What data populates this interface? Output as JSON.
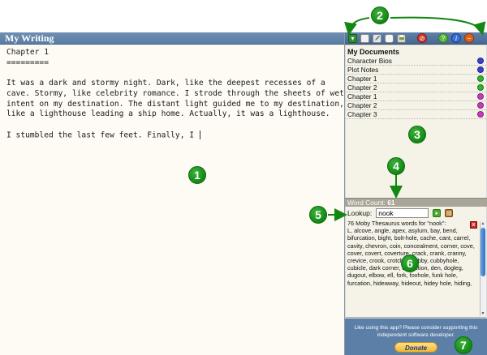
{
  "callouts": [
    "1",
    "2",
    "3",
    "4",
    "5",
    "6",
    "7"
  ],
  "editor": {
    "title": "My Writing",
    "text": "Chapter 1\n=========\n\nIt was a dark and stormy night. Dark, like the deepest recesses of a\ncave. Stormy, like celebrity romance. I strode through the sheets of wet,\nintent on my destination. The distant light guided me to my destination,\nlike a lighthouse leading a ship home. Actually, it was a lighthouse.\n\nI stumbled the last few feet. Finally, I "
  },
  "toolbar": {
    "icons": [
      "save-icon",
      "new-document-icon",
      "edit-icon",
      "comment-icon",
      "print-icon",
      "stop-icon",
      "help-icon",
      "info-icon",
      "remove-icon"
    ]
  },
  "documents": {
    "title": "My Documents",
    "items": [
      {
        "label": "Character Bios",
        "color": "#3a3fd6"
      },
      {
        "label": "Plot Notes",
        "color": "#3a3fd6"
      },
      {
        "label": "Chapter 1",
        "color": "#2fb52f"
      },
      {
        "label": "Chapter 2",
        "color": "#2fb52f"
      },
      {
        "label": "Chapter 1",
        "color": "#c53bbf"
      },
      {
        "label": "Chapter 2",
        "color": "#c53bbf"
      },
      {
        "label": "Chapter 3",
        "color": "#c53bbf"
      }
    ]
  },
  "word_count": {
    "label": "Word Count:",
    "value": "61"
  },
  "lookup": {
    "label": "Lookup:",
    "value": "nook",
    "close_label": "x",
    "results_header": "76 Moby Thesaurus words for \"nook\":",
    "results": "L, alcove, angle, apex, asylum, bay, bend, bifurcation, bight, bolt-hole, cache, cant, carrel, cavity, chevron, coin, concealment, corner, cove, cover, covert, coverture, crack, crank, cranny, crevice, crook, crotchet, cubby, cubbyhole, cubicle, dark corner, deflection, den, dogleg, dugout, elbow, ell, fork, foxhole, funk hole, furcation, hideaway, hideout, hidey hole, hiding,"
  },
  "support": {
    "text": "Like using this app? Please consider supporting this independent software developer.",
    "donate_label": "Donate"
  },
  "colors": {
    "header_blue": "#5a7da5",
    "callout_green": "#128712",
    "panel_cream": "#f5f3e8",
    "support_blue": "#5c7fa8"
  }
}
